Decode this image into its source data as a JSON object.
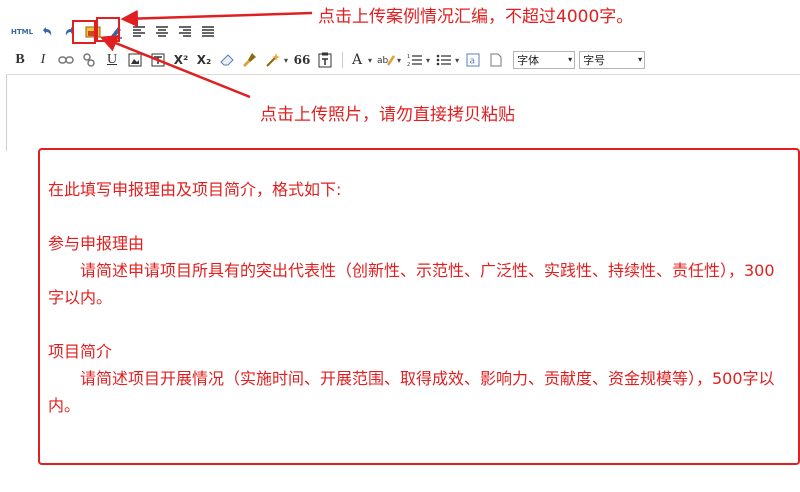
{
  "toolbar": {
    "html_label": "HTML",
    "font_family_select": "字体",
    "font_size_select": "字号",
    "bold": "B",
    "italic": "I",
    "underline": "U",
    "superscript": "X²",
    "subscript": "X₂",
    "quote": "66",
    "font_color": "A",
    "highlight_color": "ab",
    "row1_icons": [
      "html-source-icon",
      "undo-icon",
      "redo-icon",
      "upload-case-icon",
      "upload-photo-icon",
      "align-left-icon",
      "align-center-icon",
      "align-right-icon",
      "align-justify-icon"
    ],
    "row2_icons": [
      "bold-icon",
      "italic-icon",
      "link-icon",
      "unlink-icon",
      "underline-icon",
      "image-icon",
      "strikethrough-icon",
      "superscript-icon",
      "subscript-icon",
      "eraser-icon",
      "format-brush-icon",
      "magic-icon",
      "quote-icon",
      "paste-text-icon",
      "font-color-icon",
      "highlight-icon",
      "ordered-list-icon",
      "unordered-list-icon",
      "bracket-icon",
      "page-icon"
    ]
  },
  "annotations": {
    "upload_case": "点击上传案例情况汇编，不超过4000字。",
    "upload_photo": "点击上传照片，请勿直接拷贝粘贴"
  },
  "notice": {
    "intro": "在此填写申报理由及项目简介，格式如下:",
    "section1_title": "参与申报理由",
    "section1_body": "请简述申请项目所具有的突出代表性（创新性、示范性、广泛性、实践性、持续性、责任性），300字以内。",
    "section2_title": "项目简介",
    "section2_body": "请简述项目开展情况（实施时间、开展范围、取得成效、影响力、贡献度、资金规模等），500字以内。"
  },
  "colors": {
    "annotation_red": "#e02020"
  }
}
